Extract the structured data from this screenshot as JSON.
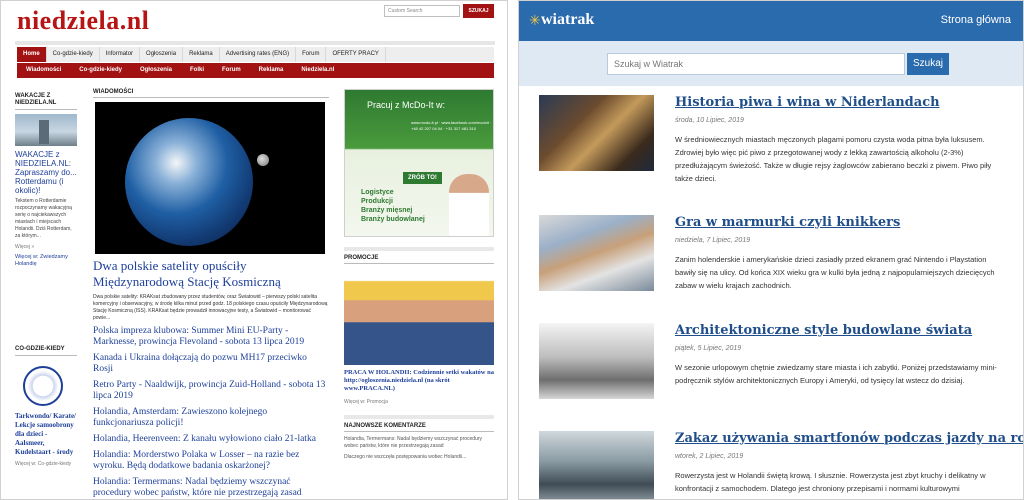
{
  "left_site": {
    "logo": "niedziela.nl",
    "search_placeholder": "Custom Search",
    "search_button": "SZUKAJ",
    "nav_main": [
      "Home",
      "Co-gdzie-kiedy",
      "Informator",
      "Ogłoszenia",
      "Reklama",
      "Advertising rates (ENG)",
      "Forum",
      "OFERTY PRACY"
    ],
    "nav_sub": [
      "Wiadomości",
      "Co-gdzie-kiedy",
      "Ogłoszenia",
      "Folki",
      "Forum",
      "Reklama",
      "Niedziela.nl"
    ],
    "sidebar": {
      "heading": "WAKACJE Z NIEDZIELA.NL",
      "title": "WAKACJE z NIEDZIELA.NL: Zapraszamy do... Rotterdamu (i okolic)!",
      "text": "Tekstem o Rotterdamie rozpoczynamy wakacyjną serię o najciekawszych miastach i miejscach Holandii. Dziś Rotterdam, za którym...",
      "more": "Więcej »",
      "link": "Więcej w: Zwiedzamy Holandię"
    },
    "sidebar2": {
      "heading": "CO-GDZIE-KIEDY",
      "title": "Tarkwondo/ Karate/ Lekcje samoobrony dla dzieci - Aalsmeer, Kudelstaart - środy",
      "more": "Więcej w: Co-gdzie-kiedy"
    },
    "main": {
      "heading": "WIADOMOŚCI",
      "title": "Dwa polskie satelity opuściły Międzynarodową Stację Kosmiczną",
      "text": "Dwa polskie satelity: KRAKsat zbudowany przez studentów, oraz Światowid – pierwszy polski satelita komercyjny i obserwacyjny, w środę kilka minut przed godz. 18 polskiego czasu opuściły Międzynarodową Stację Kosmiczną (ISS). KRAKsat będzie prowadził innowacyjne testy, a Światowid – monitorować powie...",
      "headlines": [
        "Polska impreza klubowa: Summer Mini EU-Party - Marknesse, prowincja Flevoland - sobota 13 lipca 2019",
        "Kanada i Ukraina dołączają do pozwu MH17 przeciwko Rosji",
        "Retro Party - Naaldwijk, prowincja Zuid-Holland - sobota 13 lipca 2019",
        "Holandia, Amsterdam: Zawieszono kolejnego funkcjonariusza policji!",
        "Holandia, Heerenveen: Z kanału wyłowiono ciało 21-latka",
        "Holandia: Morderstwo Polaka w Losser – na razie bez wyroku. Będą dodatkowe badania oskarżonej?",
        "Holandia: Termermans: Nadal będziemy wszczynać procedury wobec państw, które nie przestrzegają zasad"
      ]
    },
    "right_col": {
      "ad_line": "Pracuj z McDo-It w:",
      "ad_small": "www.mcdo-it.pl · www.facebook.com/mcdoit · +48 42 207 04 04 · +31 317 481 310",
      "ad_cta": "ZRÓB TO!",
      "ad_list": [
        "Logistyce",
        "Produkcji",
        "Branży mięsnej",
        "Branży budowlanej"
      ],
      "promo_heading": "PROMOCJE",
      "promo_title": "PRACA W HOLANDII: Codziennie setki wakatów na http://ogloszenia.niedziela.nl (na skrót www.PRACA.NL)",
      "promo_more": "Więcej w: Promocja",
      "comments_heading": "NAJNOWSZE KOMENTARZE",
      "comments": [
        "Holandia, Termermans: Nadal będziemy wszczynać procedury wobec państw, które nie przestrzegają zasad",
        "Dlaczego nie wszczęła postępowania wobec Holandii..."
      ]
    }
  },
  "right_site": {
    "logo": "wiatrak",
    "home_link": "Strona główna",
    "search_placeholder": "Szukaj w Wiatrak",
    "search_button": "Szukaj",
    "articles": [
      {
        "title": "Historia piwa i wina w Niderlandach",
        "date": "środa, 10 Lipiec, 2019",
        "text": "W średniowiecznych miastach męczonych plagami pomoru czysta woda pitna była luksusem. Zdrowiej było więc pić piwo z przegotowanej wody z lekką zawartością alkoholu (2-3%) przedłużającym świeżość. Także w długie rejsy żaglowców zabierano beczki z piwem. Piwo piły także dzieci."
      },
      {
        "title": "Gra w marmurki czyli knikkers",
        "date": "niedziela, 7 Lipiec, 2019",
        "text": "Zanim holenderskie i amerykańskie dzieci zasiadły przed ekranem grać Nintendo i Playstation bawiły się na ulicy. Od końca XIX wieku gra w kulki była jedną z najpopularniejszych dziecięcych zabaw w wielu krajach zachodnich."
      },
      {
        "title": "Architektoniczne style budowlane świata",
        "date": "piątek, 5 Lipiec, 2019",
        "text": "W sezonie urlopowym chętnie zwiedzamy stare miasta i ich zabytki. Poniżej przedstawiamy mini-podręcznik stylów architektonicznych Europy i Ameryki, od tysięcy lat wstecz do dzisiaj."
      },
      {
        "title": "Zakaz używania smartfonów podczas jazdy na rowerze",
        "date": "wtorek, 2 Lipiec, 2019",
        "text": "Rowerzysta jest w Holandii świętą krową. I słusznie. Rowerzysta jest zbyt kruchy i delikatny w konfrontacji z samochodem. Dlatego jest chroniony przepisami i normami kulturowymi"
      }
    ]
  },
  "colors": {
    "niedziela_red": "#a31212",
    "niedziela_link": "#1d3f99",
    "wiatrak_blue": "#2a6bae",
    "wiatrak_title": "#1f4e8a"
  }
}
